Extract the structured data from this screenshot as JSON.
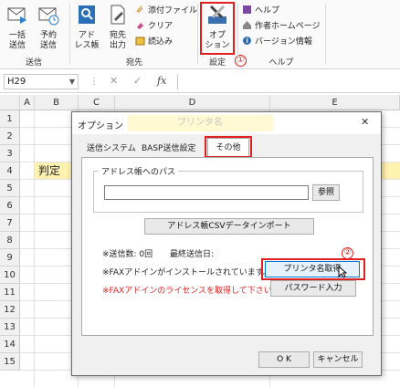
{
  "ribbon": {
    "groups": {
      "send": "送信",
      "dest": "宛先",
      "settings": "設定",
      "help": "ヘルプ"
    },
    "buttons": {
      "batch_send": [
        "一括",
        "送信"
      ],
      "scheduled_send": [
        "予約",
        "送信"
      ],
      "address_book": [
        "アド",
        "レス帳"
      ],
      "dest_output": [
        "宛先",
        "出力"
      ],
      "option": [
        "オプ",
        "ション"
      ]
    },
    "small": {
      "attach": "添付ファイル",
      "clear": "クリア",
      "read": "読込み",
      "help": "ヘルプ",
      "homepage": "作者ホームページ",
      "version": "バージョン情報"
    },
    "annotation1": "①"
  },
  "formula_bar": {
    "cell_ref": "H29",
    "fx": "fx",
    "cancel": "✕",
    "confirm": "✓"
  },
  "sheet": {
    "columns": [
      "A",
      "B",
      "C",
      "D",
      "E"
    ],
    "rows": [
      "1",
      "2",
      "3",
      "4",
      "5",
      "6",
      "7",
      "8",
      "9",
      "10",
      "11",
      "12",
      "13",
      "14",
      "15"
    ],
    "cell_b4": "判定",
    "highlight_color": "#fff2b0"
  },
  "dialog": {
    "title": "オプション",
    "title_tag": "プリンタ名",
    "close": "✕",
    "tabs": [
      "送信システム",
      "BASP送信設定",
      "その他"
    ],
    "address_path_label": "アドレス帳へのパス",
    "path_value": "",
    "browse": "参照",
    "csv_import": "アドレス帳CSVデータインポート",
    "send_count": "※送信数: 0回",
    "last_send": "最終送信日:",
    "fax_installed": "※FAXアドインがインストールされています。",
    "fax_license": "※FAXアドインのライセンスを取得して下さい。",
    "get_printer": "プリンタ名取得",
    "password_input": "パスワード入力",
    "ok": "O K",
    "cancel": "キャンセル",
    "annotation2": "②",
    "warn_color": "#e02020"
  }
}
